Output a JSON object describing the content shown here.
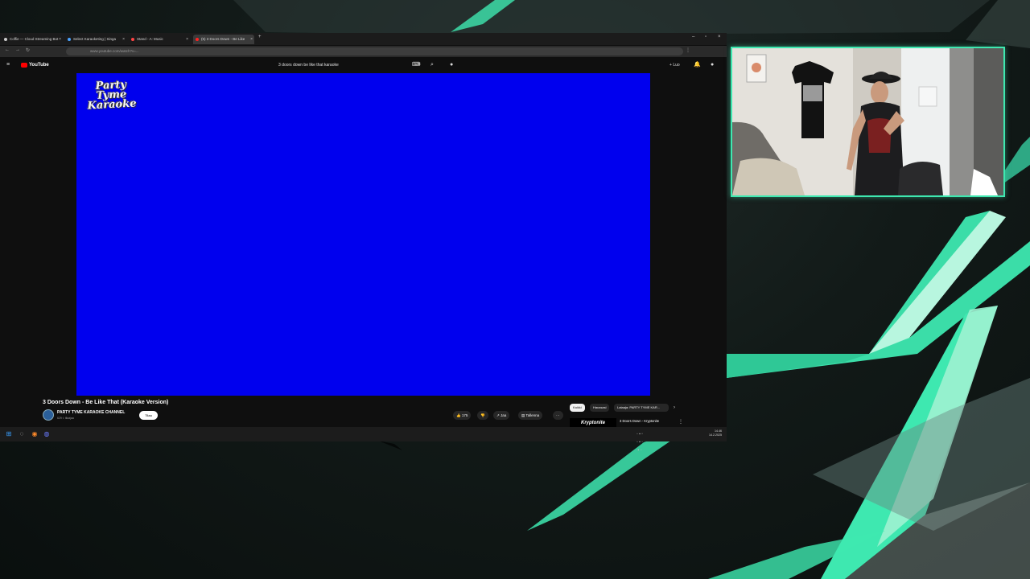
{
  "tabs": [
    {
      "label": "Coffie — Cloud Streaming Bot",
      "fav_color": "#cccccc"
    },
    {
      "label": "Select Karaoketing | Singa",
      "fav_color": "#4aa3ff"
    },
    {
      "label": "Stand - A: Music",
      "fav_color": "#ff4444"
    },
    {
      "label": "(5) 3 Doors Down - Be Like",
      "fav_color": "#ff2222"
    }
  ],
  "address": "www.youtube.com/watch?v=...",
  "youtube": {
    "logo_label": "YouTube",
    "search_query": "3 doors down be like that karaoke",
    "create_label": "Luo"
  },
  "video": {
    "logo_text": "Party Tyme Karaoke",
    "title": "3 Doors Down - Be Like That (Karaoke Version)",
    "channel": "PARTY TYME KARAOKE CHANNEL",
    "subs": "629 t. tilaajaa",
    "join_label": "Tilaa",
    "likes": "175",
    "share_label": "Jaa",
    "save_label": "Tallenna",
    "more_label": "···"
  },
  "chips": [
    {
      "label": "Kaikki",
      "active": true
    },
    {
      "label": "Haussasi",
      "active": false
    },
    {
      "label": "Lataaja: PARTY TYME KAR...",
      "active": false
    }
  ],
  "up_next": {
    "thumb_text": "Kryptonite",
    "title": "3 Doors Down - Kryptonite"
  },
  "taskbar": {
    "time": "14.46",
    "date": "14.2.2025"
  },
  "colors": {
    "accent": "#3ee8b0",
    "player_bg": "#0000ee",
    "yt_red": "#ff0000"
  }
}
